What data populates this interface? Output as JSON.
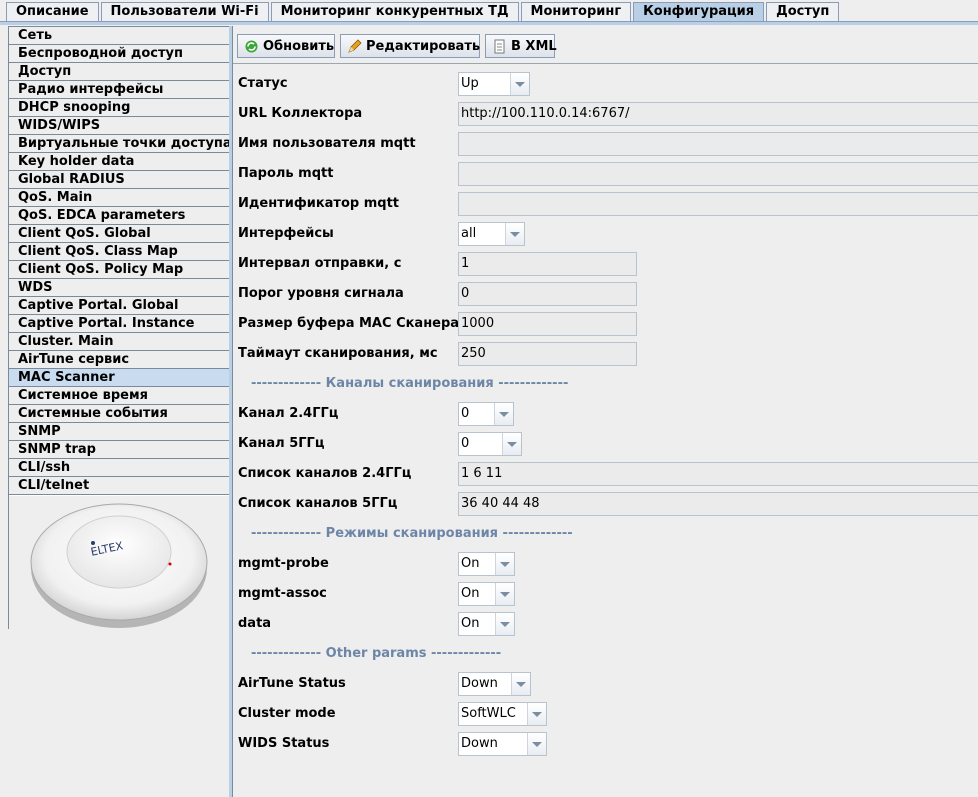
{
  "tabs": [
    {
      "label": "Описание"
    },
    {
      "label": "Пользователи Wi-Fi"
    },
    {
      "label": "Мониторинг конкурентных ТД"
    },
    {
      "label": "Мониторинг"
    },
    {
      "label": "Конфигурация",
      "active": true
    },
    {
      "label": "Доступ"
    }
  ],
  "sidebar": {
    "items": [
      {
        "label": "Сеть"
      },
      {
        "label": "Беспроводной доступ"
      },
      {
        "label": "Доступ"
      },
      {
        "label": "Радио интерфейсы"
      },
      {
        "label": "DHCP snooping"
      },
      {
        "label": "WIDS/WIPS"
      },
      {
        "label": "Виртуальные точки доступа"
      },
      {
        "label": "Key holder data"
      },
      {
        "label": "Global RADIUS"
      },
      {
        "label": "QoS. Main"
      },
      {
        "label": "QoS. EDCA parameters"
      },
      {
        "label": "Client QoS. Global"
      },
      {
        "label": "Client QoS. Class Map"
      },
      {
        "label": "Client QoS. Policy Map"
      },
      {
        "label": "WDS"
      },
      {
        "label": "Captive Portal. Global"
      },
      {
        "label": "Captive Portal. Instance"
      },
      {
        "label": "Cluster. Main"
      },
      {
        "label": "AirTune сервис"
      },
      {
        "label": "MAC Scanner",
        "selected": true
      },
      {
        "label": "Системное время"
      },
      {
        "label": "Системные события"
      },
      {
        "label": "SNMP"
      },
      {
        "label": "SNMP trap"
      },
      {
        "label": "CLI/ssh"
      },
      {
        "label": "CLI/telnet"
      }
    ],
    "device_logo": "ELTEX"
  },
  "toolbar": {
    "refresh_label": "Обновить",
    "edit_label": "Редактировать",
    "xml_label": "В XML"
  },
  "form": {
    "status": {
      "label": "Статус",
      "value": "Up"
    },
    "collector_url": {
      "label": "URL Коллектора",
      "value": "http://100.110.0.14:6767/"
    },
    "mqtt_user": {
      "label": "Имя пользователя mqtt",
      "value": ""
    },
    "mqtt_password": {
      "label": "Пароль mqtt",
      "value": ""
    },
    "mqtt_id": {
      "label": "Идентификатор mqtt",
      "value": ""
    },
    "interfaces": {
      "label": "Интерфейсы",
      "value": "all"
    },
    "send_interval": {
      "label": "Интервал отправки, с",
      "value": "1"
    },
    "signal_threshold": {
      "label": "Порог уровня сигнала",
      "value": "0"
    },
    "buffer_size": {
      "label": "Размер буфера MAC Сканера",
      "value": "1000"
    },
    "scan_timeout": {
      "label": "Таймаут сканирования, мс",
      "value": "250"
    },
    "sep_channels": "------------- Каналы сканирования -------------",
    "channel_24": {
      "label": "Канал 2.4ГГц",
      "value": "0"
    },
    "channel_5": {
      "label": "Канал 5ГГц",
      "value": "0"
    },
    "channels_list_24": {
      "label": "Список каналов 2.4ГГц",
      "value": "1 6 11"
    },
    "channels_list_5": {
      "label": "Список каналов 5ГГц",
      "value": "36 40 44 48"
    },
    "sep_modes": "------------- Режимы сканирования -------------",
    "mgmt_probe": {
      "label": "mgmt-probe",
      "value": "On"
    },
    "mgmt_assoc": {
      "label": "mgmt-assoc",
      "value": "On"
    },
    "data": {
      "label": "data",
      "value": "On"
    },
    "sep_other": "------------- Other params -------------",
    "airtune_status": {
      "label": "AirTune Status",
      "value": "Down"
    },
    "cluster_mode": {
      "label": "Cluster mode",
      "value": "SoftWLC"
    },
    "wids_status": {
      "label": "WIDS Status",
      "value": "Down"
    }
  },
  "colors": {
    "accent": "#b8cfe5",
    "selected": "#c9dcef",
    "separator": "#6d86a8"
  }
}
